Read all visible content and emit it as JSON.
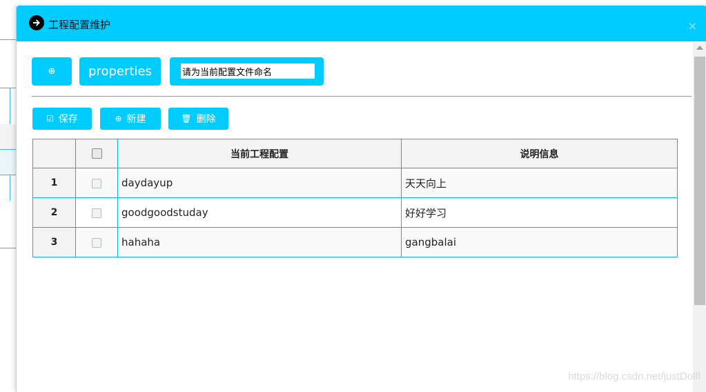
{
  "dialog": {
    "title": "工程配置维护",
    "close_label": "×"
  },
  "tabs": {
    "add_tab_icon": "⊕",
    "properties_label": "properties",
    "name_input_value": "请为当前配置文件命名"
  },
  "toolbar": {
    "save_icon": "☑",
    "save_label": "保存",
    "new_icon": "⊕",
    "new_label": "新建",
    "delete_icon": "🗑",
    "delete_label": "删除"
  },
  "table": {
    "columns": [
      "当前工程配置",
      "说明信息"
    ],
    "rows": [
      {
        "num": "1",
        "config": "daydayup",
        "desc": "天天向上"
      },
      {
        "num": "2",
        "config": "goodgoodstuday",
        "desc": "好好学习"
      },
      {
        "num": "3",
        "config": "hahaha",
        "desc": "gangbalai"
      }
    ]
  },
  "watermark": "https://blog.csdn.net/justDolfl",
  "colors": {
    "accent": "#00ccff",
    "border": "#00b4e6"
  }
}
